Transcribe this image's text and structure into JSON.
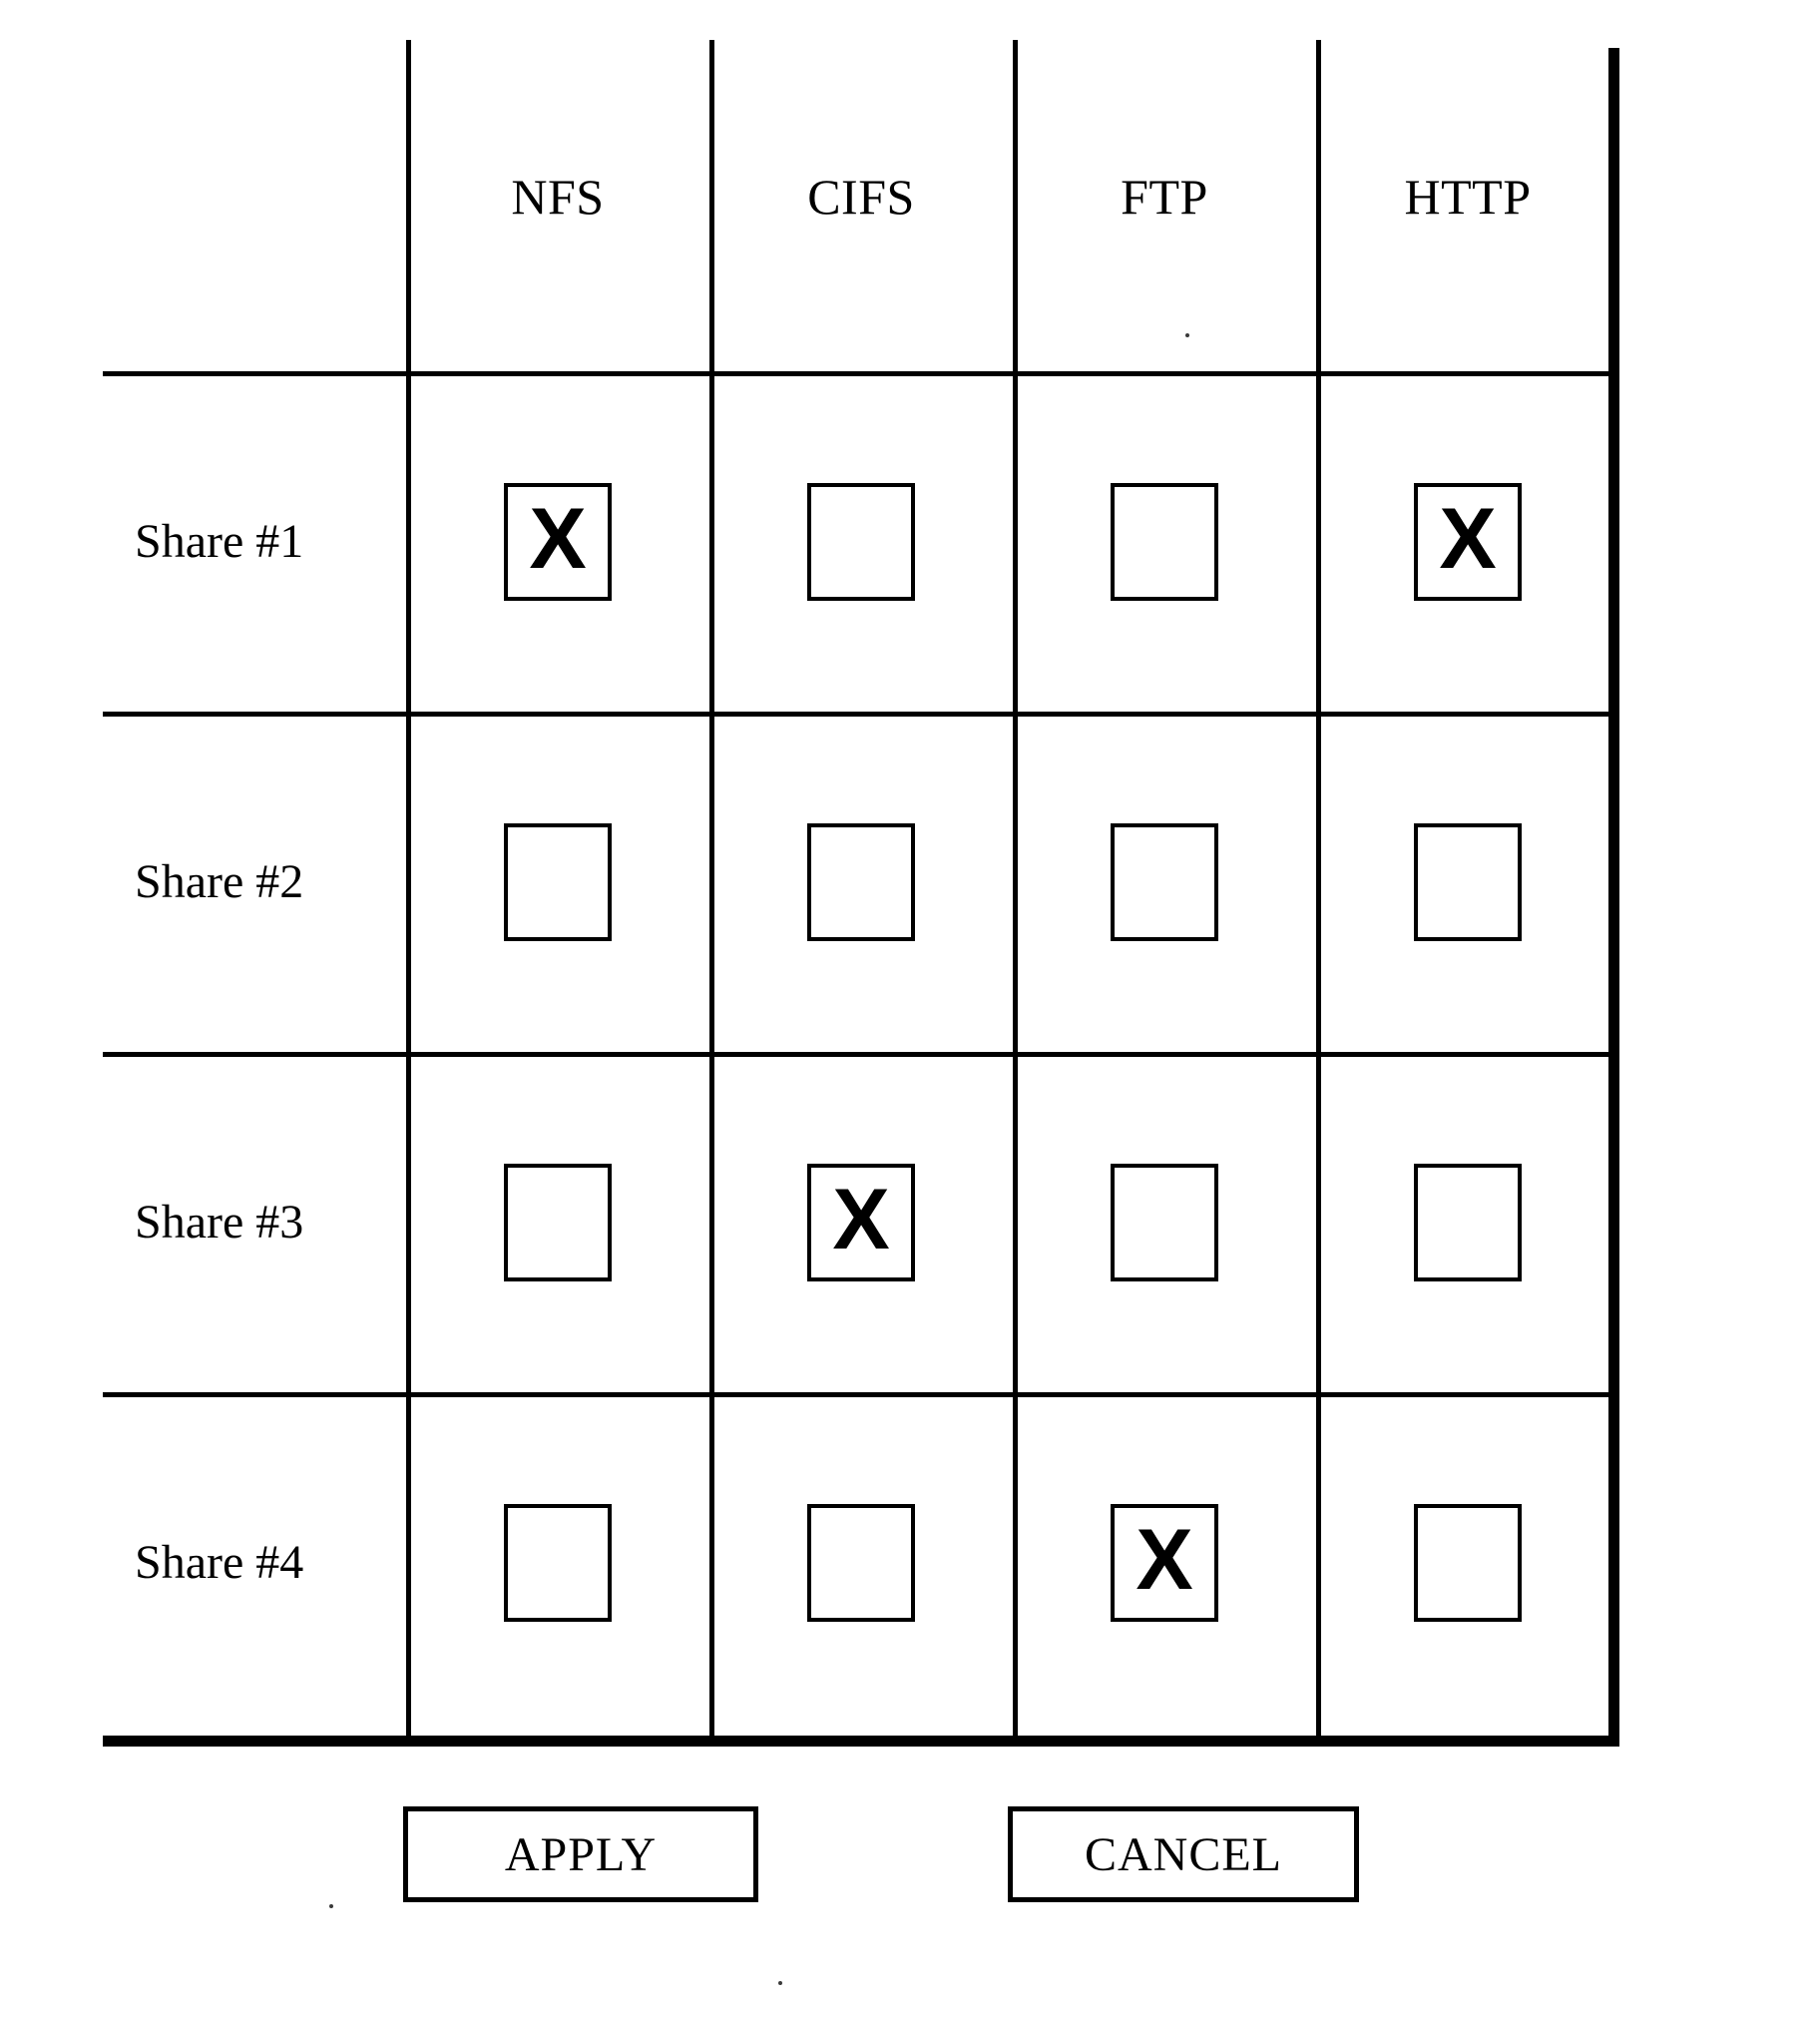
{
  "dialog": {
    "name": "share-protocol-permissions-table"
  },
  "table": {
    "row_header_label": "",
    "columns": [
      {
        "key": "nfs",
        "label": "NFS"
      },
      {
        "key": "cifs",
        "label": "CIFS"
      },
      {
        "key": "ftp",
        "label": "FTP"
      },
      {
        "key": "http",
        "label": "HTTP"
      }
    ],
    "checked_glyph": "X",
    "unchecked_glyph": "",
    "rows": [
      {
        "label": "Share #1",
        "cells": [
          {
            "column": "NFS",
            "checked": true,
            "glyph": "X"
          },
          {
            "column": "CIFS",
            "checked": false,
            "glyph": ""
          },
          {
            "column": "FTP",
            "checked": false,
            "glyph": ""
          },
          {
            "column": "HTTP",
            "checked": true,
            "glyph": "X"
          }
        ]
      },
      {
        "label": "Share #2",
        "cells": [
          {
            "column": "NFS",
            "checked": false,
            "glyph": ""
          },
          {
            "column": "CIFS",
            "checked": false,
            "glyph": ""
          },
          {
            "column": "FTP",
            "checked": false,
            "glyph": ""
          },
          {
            "column": "HTTP",
            "checked": false,
            "glyph": ""
          }
        ]
      },
      {
        "label": "Share #3",
        "cells": [
          {
            "column": "NFS",
            "checked": false,
            "glyph": ""
          },
          {
            "column": "CIFS",
            "checked": true,
            "glyph": "X"
          },
          {
            "column": "FTP",
            "checked": false,
            "glyph": ""
          },
          {
            "column": "HTTP",
            "checked": false,
            "glyph": ""
          }
        ]
      },
      {
        "label": "Share #4",
        "cells": [
          {
            "column": "NFS",
            "checked": false,
            "glyph": ""
          },
          {
            "column": "CIFS",
            "checked": false,
            "glyph": ""
          },
          {
            "column": "FTP",
            "checked": true,
            "glyph": "X"
          },
          {
            "column": "HTTP",
            "checked": false,
            "glyph": ""
          }
        ]
      }
    ]
  },
  "buttons": {
    "apply_label": "APPLY",
    "cancel_label": "CANCEL"
  },
  "colors": {
    "ink": "#000000",
    "paper": "#ffffff"
  }
}
